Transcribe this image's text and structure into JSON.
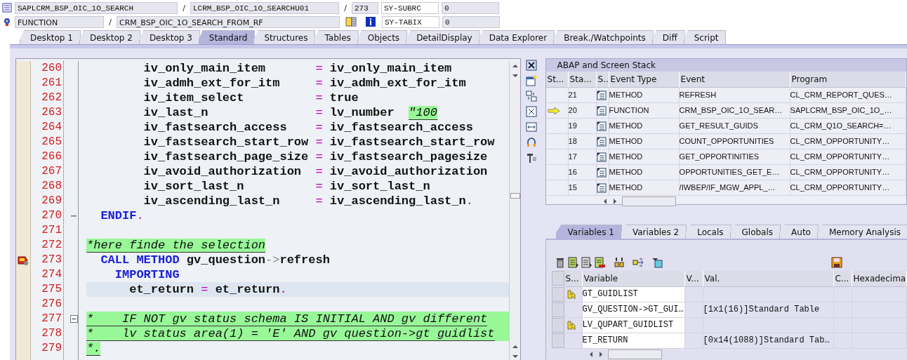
{
  "header": {
    "row1": {
      "program": "SAPLCRM_BSP_OIC_1O_SEARCH",
      "include": "LCRM_BSP_OIC_1O_SEARCHU01",
      "line": "273",
      "sysfield": "SY-SUBRC",
      "sysvalue": "0"
    },
    "row2": {
      "event_type": "FUNCTION",
      "event": "CRM_BSP_OIC_1O_SEARCH_FROM_RF",
      "sysfield": "SY-TABIX",
      "sysvalue": "0"
    },
    "separator": "/"
  },
  "tabs": [
    {
      "label": "Desktop 1",
      "selected": false
    },
    {
      "label": "Desktop 2",
      "selected": false
    },
    {
      "label": "Desktop 3",
      "selected": false
    },
    {
      "label": "Standard",
      "selected": true
    },
    {
      "label": "Structures",
      "selected": false
    },
    {
      "label": "Tables",
      "selected": false
    },
    {
      "label": "Objects",
      "selected": false
    },
    {
      "label": "DetailDisplay",
      "selected": false
    },
    {
      "label": "Data Explorer",
      "selected": false
    },
    {
      "label": "Break./Watchpoints",
      "selected": false
    },
    {
      "label": "Diff",
      "selected": false
    },
    {
      "label": "Script",
      "selected": false
    }
  ],
  "code": {
    "lines": [
      {
        "number": "260",
        "breakpoint": false,
        "current": false,
        "fill": false,
        "segments": [
          {
            "kind": "text",
            "text": "        iv_only_main_item       "
          },
          {
            "kind": "op",
            "text": "="
          },
          {
            "kind": "text",
            "text": " iv_only_main_item"
          }
        ]
      },
      {
        "number": "261",
        "breakpoint": false,
        "current": false,
        "fill": false,
        "segments": [
          {
            "kind": "text",
            "text": "        iv_admh_ext_for_itm     "
          },
          {
            "kind": "op",
            "text": "="
          },
          {
            "kind": "text",
            "text": " iv_admh_ext_for_itm"
          }
        ]
      },
      {
        "number": "262",
        "breakpoint": false,
        "current": false,
        "fill": false,
        "segments": [
          {
            "kind": "text",
            "text": "        iv_item_select          "
          },
          {
            "kind": "op",
            "text": "="
          },
          {
            "kind": "text",
            "text": " true"
          }
        ]
      },
      {
        "number": "263",
        "breakpoint": false,
        "current": false,
        "fill": false,
        "segments": [
          {
            "kind": "text",
            "text": "        iv_last_n               "
          },
          {
            "kind": "op",
            "text": "="
          },
          {
            "kind": "text",
            "text": " lv_number  "
          },
          {
            "kind": "comment",
            "text": "\"100"
          }
        ]
      },
      {
        "number": "264",
        "breakpoint": false,
        "current": false,
        "fill": false,
        "segments": [
          {
            "kind": "text",
            "text": "        iv_fastsearch_access    "
          },
          {
            "kind": "op",
            "text": "="
          },
          {
            "kind": "text",
            "text": " iv_fastsearch_access"
          }
        ]
      },
      {
        "number": "265",
        "breakpoint": false,
        "current": false,
        "fill": false,
        "segments": [
          {
            "kind": "text",
            "text": "        iv_fastsearch_start_row "
          },
          {
            "kind": "op",
            "text": "="
          },
          {
            "kind": "text",
            "text": " iv_fastsearch_start_row"
          }
        ]
      },
      {
        "number": "266",
        "breakpoint": false,
        "current": false,
        "fill": false,
        "segments": [
          {
            "kind": "text",
            "text": "        iv_fastsearch_page_size "
          },
          {
            "kind": "op",
            "text": "="
          },
          {
            "kind": "text",
            "text": " iv_fastsearch_pagesize"
          }
        ]
      },
      {
        "number": "267",
        "breakpoint": false,
        "current": false,
        "fill": false,
        "segments": [
          {
            "kind": "text",
            "text": "        iv_avoid_authorization  "
          },
          {
            "kind": "op",
            "text": "="
          },
          {
            "kind": "text",
            "text": " iv_avoid_authorization"
          }
        ]
      },
      {
        "number": "268",
        "breakpoint": false,
        "current": false,
        "fill": false,
        "segments": [
          {
            "kind": "text",
            "text": "        iv_sort_last_n          "
          },
          {
            "kind": "op",
            "text": "="
          },
          {
            "kind": "text",
            "text": " iv_sort_last_n"
          }
        ]
      },
      {
        "number": "269",
        "breakpoint": false,
        "current": false,
        "fill": false,
        "segments": [
          {
            "kind": "text",
            "text": "        iv_ascending_last_n     "
          },
          {
            "kind": "op",
            "text": "="
          },
          {
            "kind": "text",
            "text": " iv_ascending_last_n"
          },
          {
            "kind": "op",
            "text": "."
          }
        ]
      },
      {
        "number": "270",
        "breakpoint": false,
        "current": false,
        "fill": false,
        "marker": {
          "kind": "block_end"
        },
        "segments": [
          {
            "kind": "keyword",
            "text": "  ENDIF"
          },
          {
            "kind": "op",
            "text": "."
          }
        ]
      },
      {
        "number": "271",
        "breakpoint": false,
        "current": false,
        "fill": false
      },
      {
        "number": "272",
        "breakpoint": false,
        "current": false,
        "fill": false,
        "segments": [
          {
            "kind": "comment",
            "text": "*here finde the selection"
          }
        ]
      },
      {
        "number": "273",
        "breakpoint": true,
        "current": false,
        "fill": false,
        "segments": [
          {
            "kind": "keyword",
            "text": "  CALL METHOD"
          },
          {
            "kind": "text",
            "text": " gv_question"
          },
          {
            "kind": "arrow",
            "text": "->"
          },
          {
            "kind": "text",
            "text": "refresh"
          }
        ]
      },
      {
        "number": "274",
        "breakpoint": false,
        "current": false,
        "fill": false,
        "segments": [
          {
            "kind": "keyword",
            "text": "    IMPORTING"
          }
        ]
      },
      {
        "number": "275",
        "breakpoint": false,
        "current": true,
        "fill": false,
        "segments": [
          {
            "kind": "text",
            "text": "      et_return "
          },
          {
            "kind": "op",
            "text": "="
          },
          {
            "kind": "text",
            "text": " et_return"
          },
          {
            "kind": "op",
            "text": "."
          }
        ]
      },
      {
        "number": "276",
        "breakpoint": false,
        "current": false,
        "fill": false
      },
      {
        "number": "277",
        "breakpoint": false,
        "current": false,
        "fill": true,
        "marker": {
          "kind": "collapse"
        },
        "segments": [
          {
            "kind": "comment",
            "text": "*    IF NOT gv status schema IS INITIAL AND gv different"
          }
        ]
      },
      {
        "number": "278",
        "breakpoint": false,
        "current": false,
        "fill": true,
        "segments": [
          {
            "kind": "comment",
            "text": "*    lv status area(1) = 'E' AND gv question->gt guidlist"
          }
        ]
      },
      {
        "number": "279",
        "breakpoint": false,
        "current": false,
        "fill": false,
        "segments": [
          {
            "kind": "comment",
            "text": "*."
          }
        ]
      }
    ]
  },
  "stack": {
    "title": "ABAP and Screen Stack",
    "columns": [
      "St...",
      "Sta...",
      "S..",
      "Event Type",
      "Event",
      "Program"
    ],
    "rows": [
      {
        "current": false,
        "level": "21",
        "event_type": "METHOD",
        "event": "REFRESH",
        "program": "CL_CRM_REPORT_QUES…"
      },
      {
        "current": true,
        "level": "20",
        "event_type": "FUNCTION",
        "event": "CRM_BSP_OIC_1O_SEAR…",
        "program": "SAPLCRM_BSP_OIC_1O_…"
      },
      {
        "current": false,
        "level": "19",
        "event_type": "METHOD",
        "event": "GET_RESULT_GUIDS",
        "program": "CL_CRM_Q1O_SEARCH=…"
      },
      {
        "current": false,
        "level": "18",
        "event_type": "METHOD",
        "event": "COUNT_OPPORTUNITIES",
        "program": "CL_CRM_OPPORTUNITY…"
      },
      {
        "current": false,
        "level": "17",
        "event_type": "METHOD",
        "event": "GET_OPPORTINITIES",
        "program": "CL_CRM_OPPORTUNITY…"
      },
      {
        "current": false,
        "level": "16",
        "event_type": "METHOD",
        "event": "OPPORTUNITIES_GET_E…",
        "program": "CL_CRM_OPPORTUNITY…"
      },
      {
        "current": false,
        "level": "15",
        "event_type": "METHOD",
        "event": "/IWBEP/IF_MGW_APPL_…",
        "program": "CL_CRM_OPPORTUNITY…"
      }
    ]
  },
  "variables": {
    "tabs": [
      {
        "label": "Variables 1",
        "selected": true
      },
      {
        "label": "Variables 2",
        "selected": false
      },
      {
        "label": "Locals",
        "selected": false
      },
      {
        "label": "Globals",
        "selected": false
      },
      {
        "label": "Auto",
        "selected": false
      },
      {
        "label": "Memory Analysis",
        "selected": false
      }
    ],
    "columns": [
      "S...",
      "Variable",
      "V...",
      "Val.",
      "C...",
      "Hexadecima"
    ],
    "rows": [
      {
        "changed": true,
        "variable": "GT_GUIDLIST"
      },
      {
        "changed": false,
        "variable": "GV_QUESTION->GT_GUI…",
        "value": "[1x1(16)]Standard Table"
      },
      {
        "changed": true,
        "variable": "LV_QUPART_GUIDLIST"
      },
      {
        "changed": false,
        "variable": "ET_RETURN",
        "value": "[0x14(1088)]Standard Tab…"
      }
    ]
  }
}
